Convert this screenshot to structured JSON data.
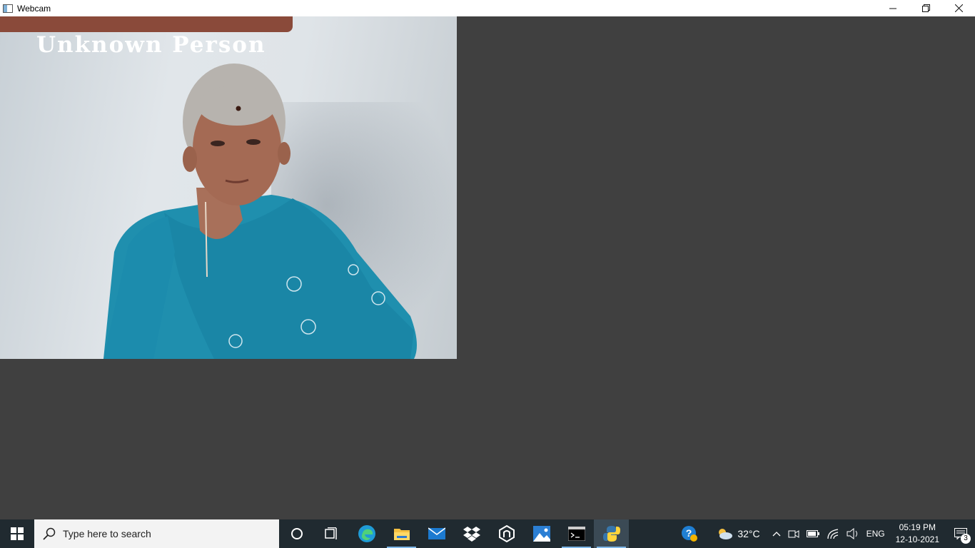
{
  "window": {
    "title": "Webcam",
    "controls": {
      "minimize": "—",
      "restore": "❐",
      "close": "✕"
    }
  },
  "webcam": {
    "label": "Unknown Person"
  },
  "taskbar": {
    "search_placeholder": "Type here to search",
    "apps": [
      "cortana-icon",
      "task-view-icon",
      "edge-icon",
      "file-explorer-icon",
      "mail-icon",
      "dropbox-icon",
      "github-icon",
      "photos-icon",
      "terminal-icon",
      "python-icon"
    ],
    "tray": {
      "weather": "32°C",
      "language": "ENG"
    },
    "clock": {
      "time": "05:19 PM",
      "date": "12-10-2021"
    },
    "notifications_count": "3"
  }
}
